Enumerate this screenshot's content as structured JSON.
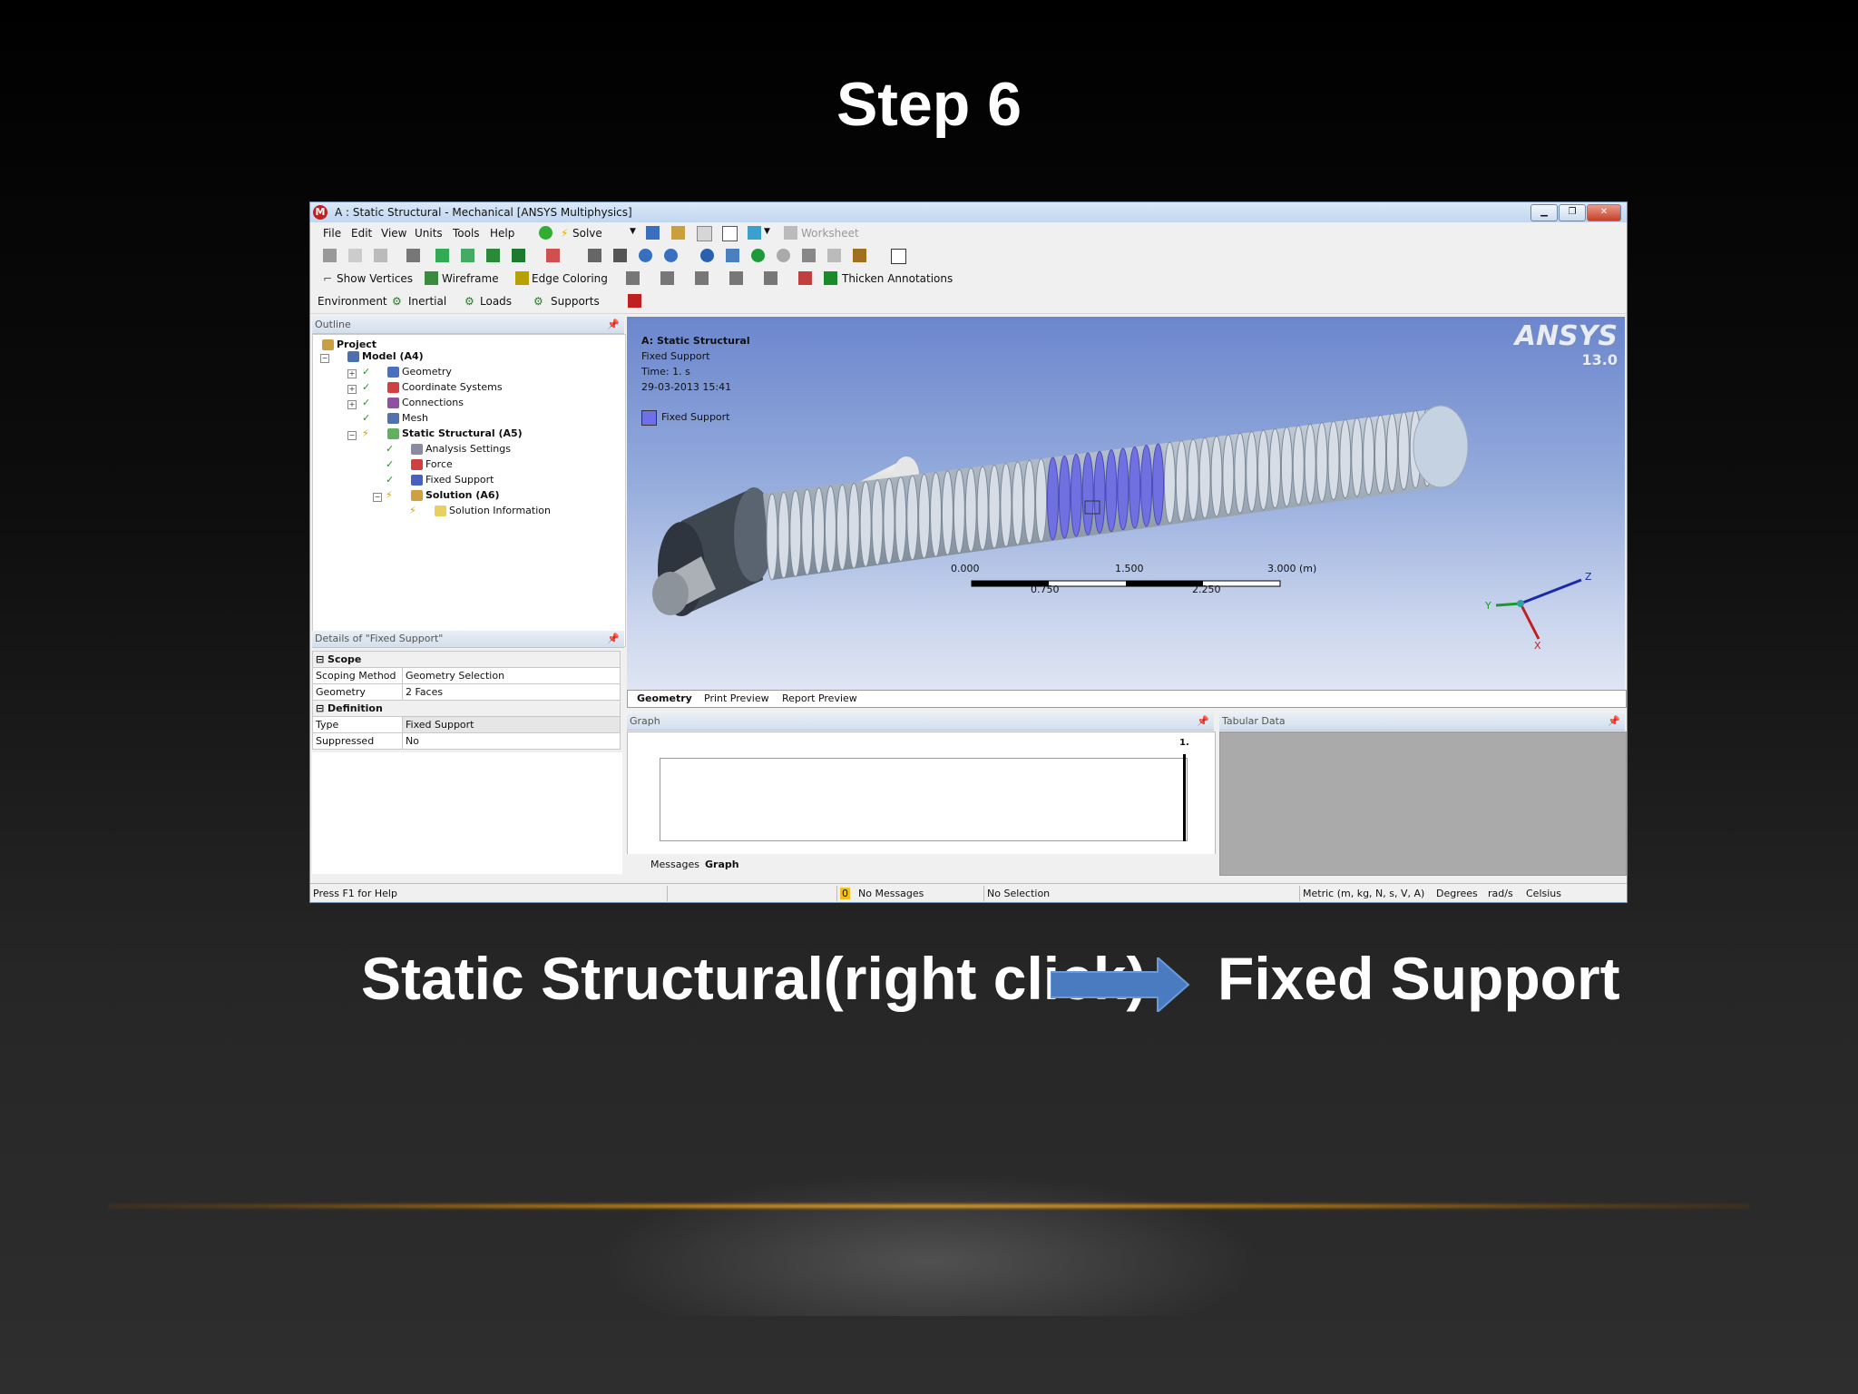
{
  "slide": {
    "title": "Step 6",
    "caption_left": "Static Structural(right click)",
    "caption_right": "Fixed Support"
  },
  "window": {
    "title": "A : Static Structural - Mechanical [ANSYS Multiphysics]",
    "app_icon_letter": "M"
  },
  "menubar": {
    "file": "File",
    "edit": "Edit",
    "view": "View",
    "units": "Units",
    "tools": "Tools",
    "help": "Help",
    "solve": "Solve",
    "worksheet": "Worksheet"
  },
  "toolbar3": {
    "show_vertices": "Show Vertices",
    "wireframe": "Wireframe",
    "edge_coloring": "Edge Coloring",
    "thicken_annotations": "Thicken Annotations"
  },
  "toolbar4": {
    "environment": "Environment",
    "inertial": "Inertial",
    "loads": "Loads",
    "supports": "Supports"
  },
  "outline": {
    "header": "Outline",
    "items": [
      {
        "label": "Project"
      },
      {
        "label": "Model (A4)"
      },
      {
        "label": "Geometry"
      },
      {
        "label": "Coordinate Systems"
      },
      {
        "label": "Connections"
      },
      {
        "label": "Mesh"
      },
      {
        "label": "Static Structural (A5)"
      },
      {
        "label": "Analysis Settings"
      },
      {
        "label": "Force"
      },
      {
        "label": "Fixed Support"
      },
      {
        "label": "Solution (A6)"
      },
      {
        "label": "Solution Information"
      }
    ]
  },
  "details": {
    "header": "Details of \"Fixed Support\"",
    "scope_group": "Scope",
    "scoping_method_label": "Scoping Method",
    "scoping_method_value": "Geometry Selection",
    "geometry_label": "Geometry",
    "geometry_value": "2 Faces",
    "definition_group": "Definition",
    "type_label": "Type",
    "type_value": "Fixed Support",
    "suppressed_label": "Suppressed",
    "suppressed_value": "No"
  },
  "viewport": {
    "analysis_title": "A: Static Structural",
    "subtitle": "Fixed Support",
    "time": "Time: 1. s",
    "date": "29-03-2013 15:41",
    "legend_label": "Fixed Support",
    "legend_color": "#6f6fe8",
    "brand": "ANSYS",
    "version": "13.0",
    "scale_0": "0.000",
    "scale_1": "1.500",
    "scale_2": "3.000 (m)",
    "scale_3": "0.750",
    "scale_4": "2.250",
    "axis_z": "Z",
    "axis_y": "Y",
    "axis_x": "X"
  },
  "view_tabs": {
    "geometry": "Geometry",
    "print_preview": "Print Preview",
    "report_preview": "Report Preview"
  },
  "graph": {
    "header": "Graph",
    "marker": "1.",
    "tab_messages": "Messages",
    "tab_graph": "Graph"
  },
  "tabular": {
    "header": "Tabular Data"
  },
  "status": {
    "help": "Press F1 for Help",
    "messages_count": "0",
    "messages": "No Messages",
    "selection": "No Selection",
    "units": "Metric (m, kg, N, s, V, A)",
    "angle": "Degrees",
    "rotation": "rad/s",
    "temperature": "Celsius"
  }
}
